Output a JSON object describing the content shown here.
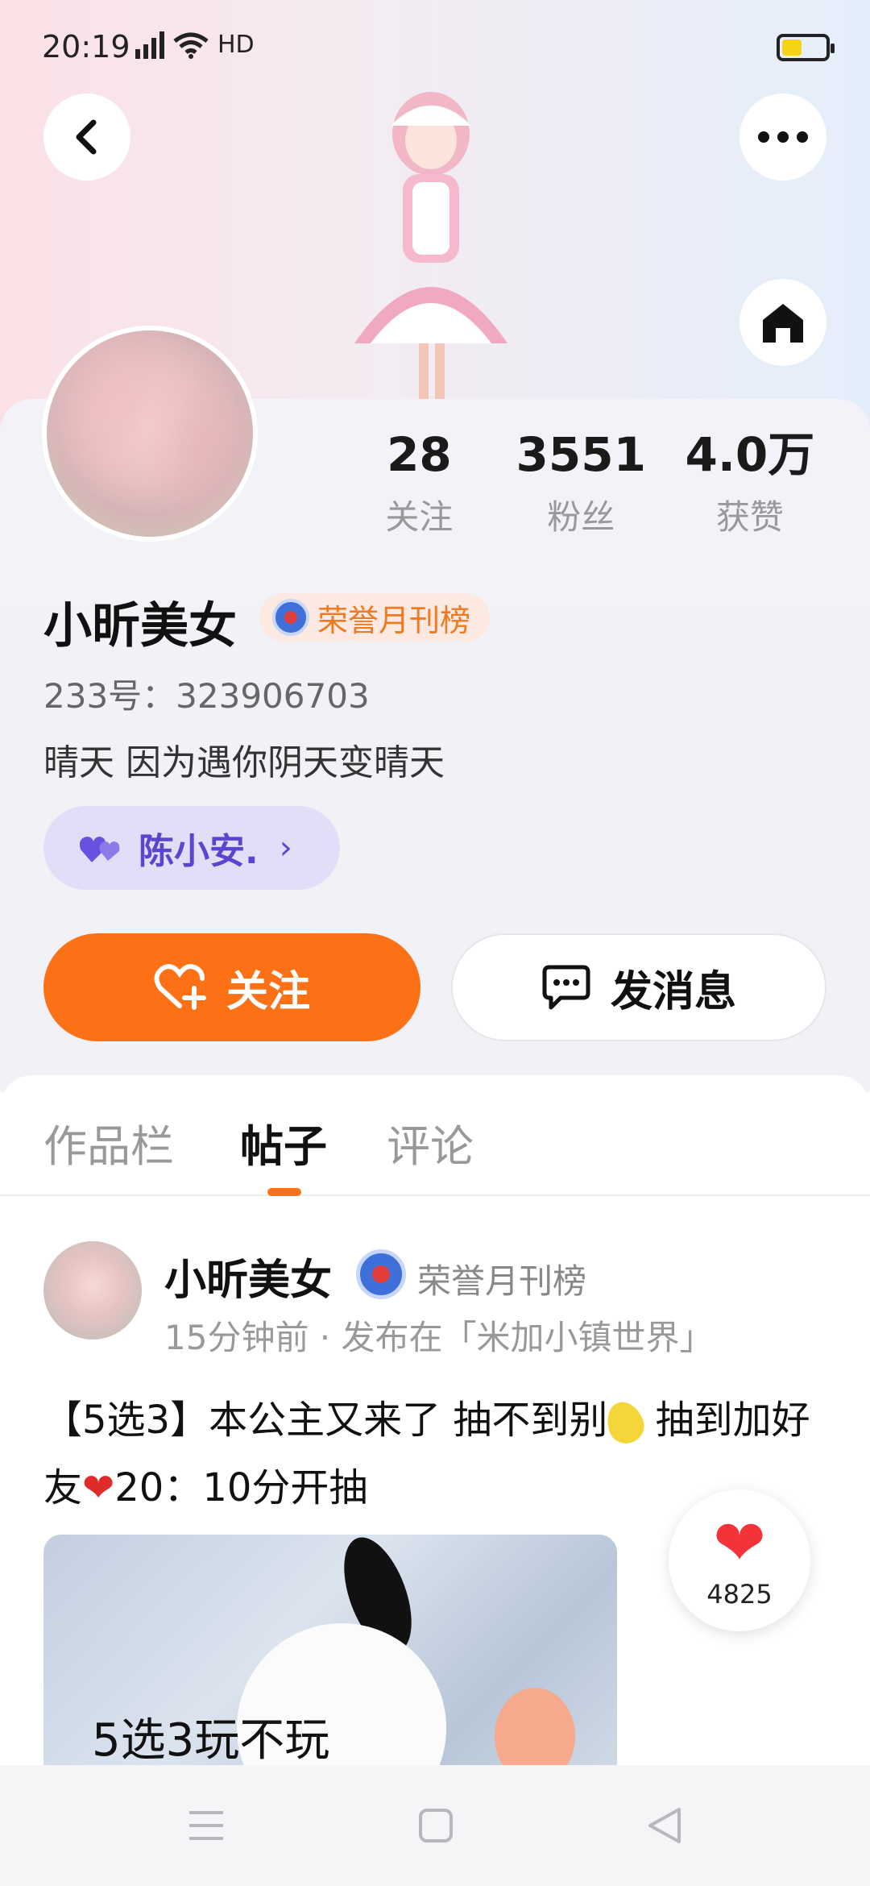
{
  "status_bar": {
    "time": "20:19",
    "network": "4G",
    "hd": "HD",
    "battery_level": 0.45
  },
  "profile": {
    "stats": [
      {
        "value": "28",
        "label": "关注"
      },
      {
        "value": "3551",
        "label": "粉丝"
      },
      {
        "value": "4.0万",
        "label": "获赞"
      }
    ],
    "name": "小昕美女",
    "honor_badge": "荣誉月刊榜",
    "uid": "233号：323906703",
    "bio": "晴天 因为遇你阴天变晴天",
    "cp_name": "陈小安.",
    "follow_label": "关注",
    "message_label": "发消息"
  },
  "tabs": [
    {
      "label": "作品栏"
    },
    {
      "label": "帖子"
    },
    {
      "label": "评论"
    }
  ],
  "post": {
    "author": "小昕美女",
    "honor": "荣誉月刊榜",
    "meta": "15分钟前 · 发布在「米加小镇世界」",
    "text_part1": "【5选3】本公主又来了 抽不到别",
    "text_part2": " 抽到加好友",
    "text_part3": "20：10分开抽",
    "image_caption": "5选3玩不玩",
    "likes": "4825"
  },
  "colors": {
    "accent": "#fd7116",
    "cp_purple": "#5a44d0",
    "like_red": "#f2343a"
  },
  "icons": [
    "back-icon",
    "more-icon",
    "home-icon",
    "heart-plus-icon",
    "chat-icon",
    "menu-icon",
    "square-icon",
    "triangle-back-icon"
  ]
}
